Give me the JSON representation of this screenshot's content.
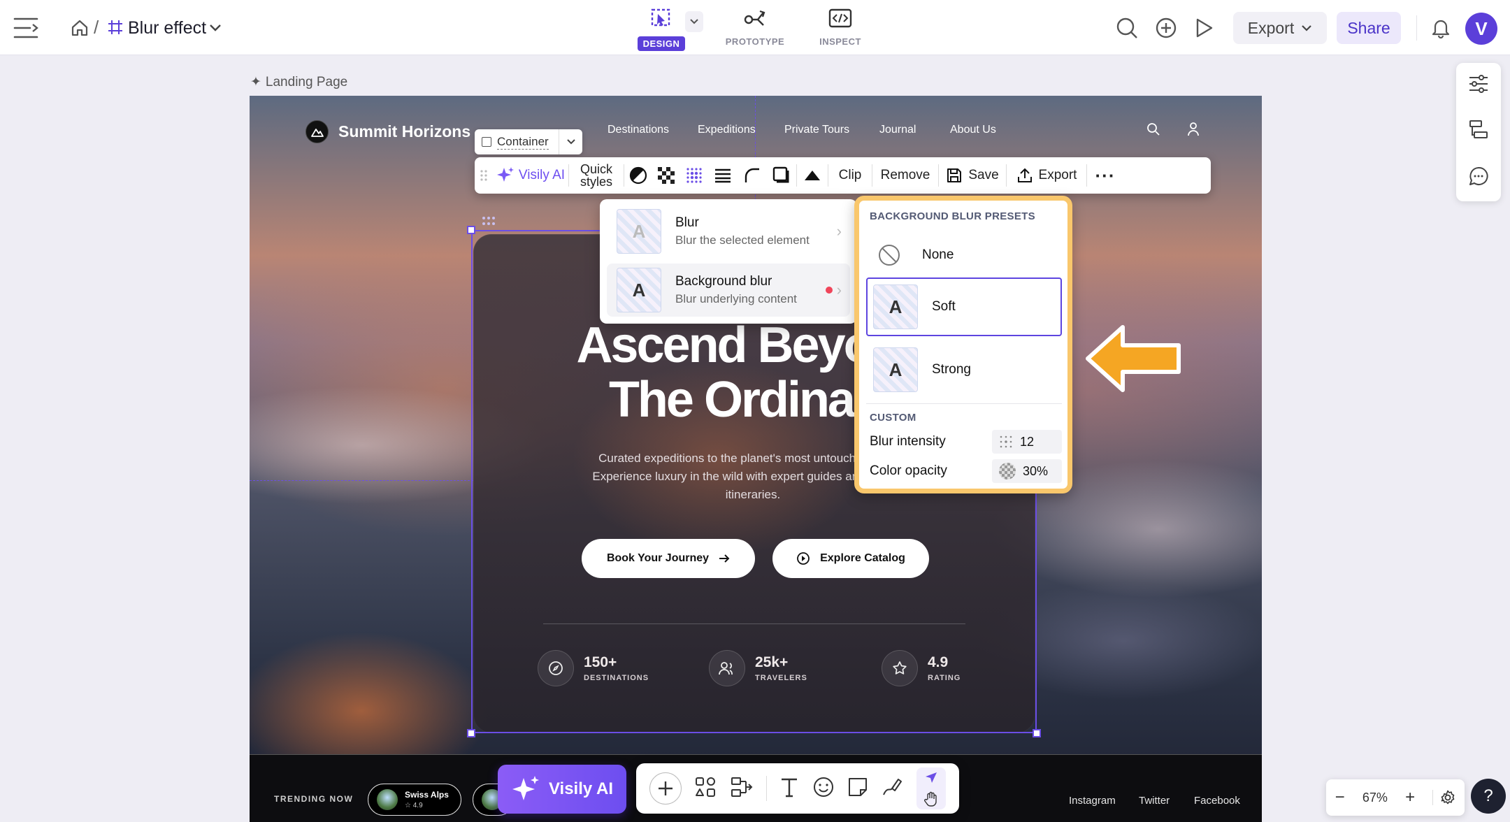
{
  "header": {
    "file_title": "Blur effect",
    "crumb_separator": "/",
    "modes": [
      {
        "label": "DESIGN",
        "active": true
      },
      {
        "label": "PROTOTYPE",
        "active": false
      },
      {
        "label": "INSPECT",
        "active": false
      }
    ],
    "export_label": "Export",
    "share_label": "Share",
    "avatar_letter": "V"
  },
  "canvas": {
    "frame_label": "Landing Page"
  },
  "site": {
    "brand": "Summit Horizons",
    "nav": [
      "Destinations",
      "Expeditions",
      "Private Tours",
      "Journal",
      "About Us"
    ],
    "hero_title": "Ascend Beyond\nThe Ordinary",
    "hero_subtitle": "Curated expeditions to the planet's most untouched peaks. Experience luxury in the wild with expert guides and bespoke itineraries.",
    "cta_primary": "Book Your Journey",
    "cta_secondary": "Explore Catalog",
    "stats": [
      {
        "value": "150+",
        "label": "DESTINATIONS",
        "icon": "compass-icon"
      },
      {
        "value": "25k+",
        "label": "TRAVELERS",
        "icon": "users-icon"
      },
      {
        "value": "4.9",
        "label": "RATING",
        "icon": "star-icon"
      }
    ],
    "trending_label": "TRENDING NOW",
    "trending": [
      {
        "name": "Swiss Alps",
        "rating": "4.9"
      }
    ],
    "social": [
      "Instagram",
      "Twitter",
      "Facebook"
    ]
  },
  "toolbar": {
    "container_label": "Container",
    "visily_ai": "Visily AI",
    "quick_styles": "Quick\nstyles",
    "clip": "Clip",
    "remove": "Remove",
    "save": "Save",
    "export": "Export"
  },
  "blur_menu": {
    "items": [
      {
        "title": "Blur",
        "desc": "Blur the selected element"
      },
      {
        "title": "Background blur",
        "desc": "Blur underlying content"
      }
    ],
    "thumb_letter": "A"
  },
  "presets": {
    "heading": "BACKGROUND BLUR PRESETS",
    "options": [
      {
        "label": "None",
        "selected": false
      },
      {
        "label": "Soft",
        "selected": true
      },
      {
        "label": "Strong",
        "selected": false
      }
    ],
    "custom_heading": "CUSTOM",
    "blur_intensity_label": "Blur intensity",
    "blur_intensity_value": "12",
    "color_opacity_label": "Color opacity",
    "color_opacity_value": "30%"
  },
  "bottom": {
    "visily_ai": "Visily AI",
    "zoom": "67%",
    "help": "?"
  },
  "colors": {
    "accent": "#5b3fd9",
    "highlight": "#f9c76c",
    "arrow": "#f5a623"
  }
}
